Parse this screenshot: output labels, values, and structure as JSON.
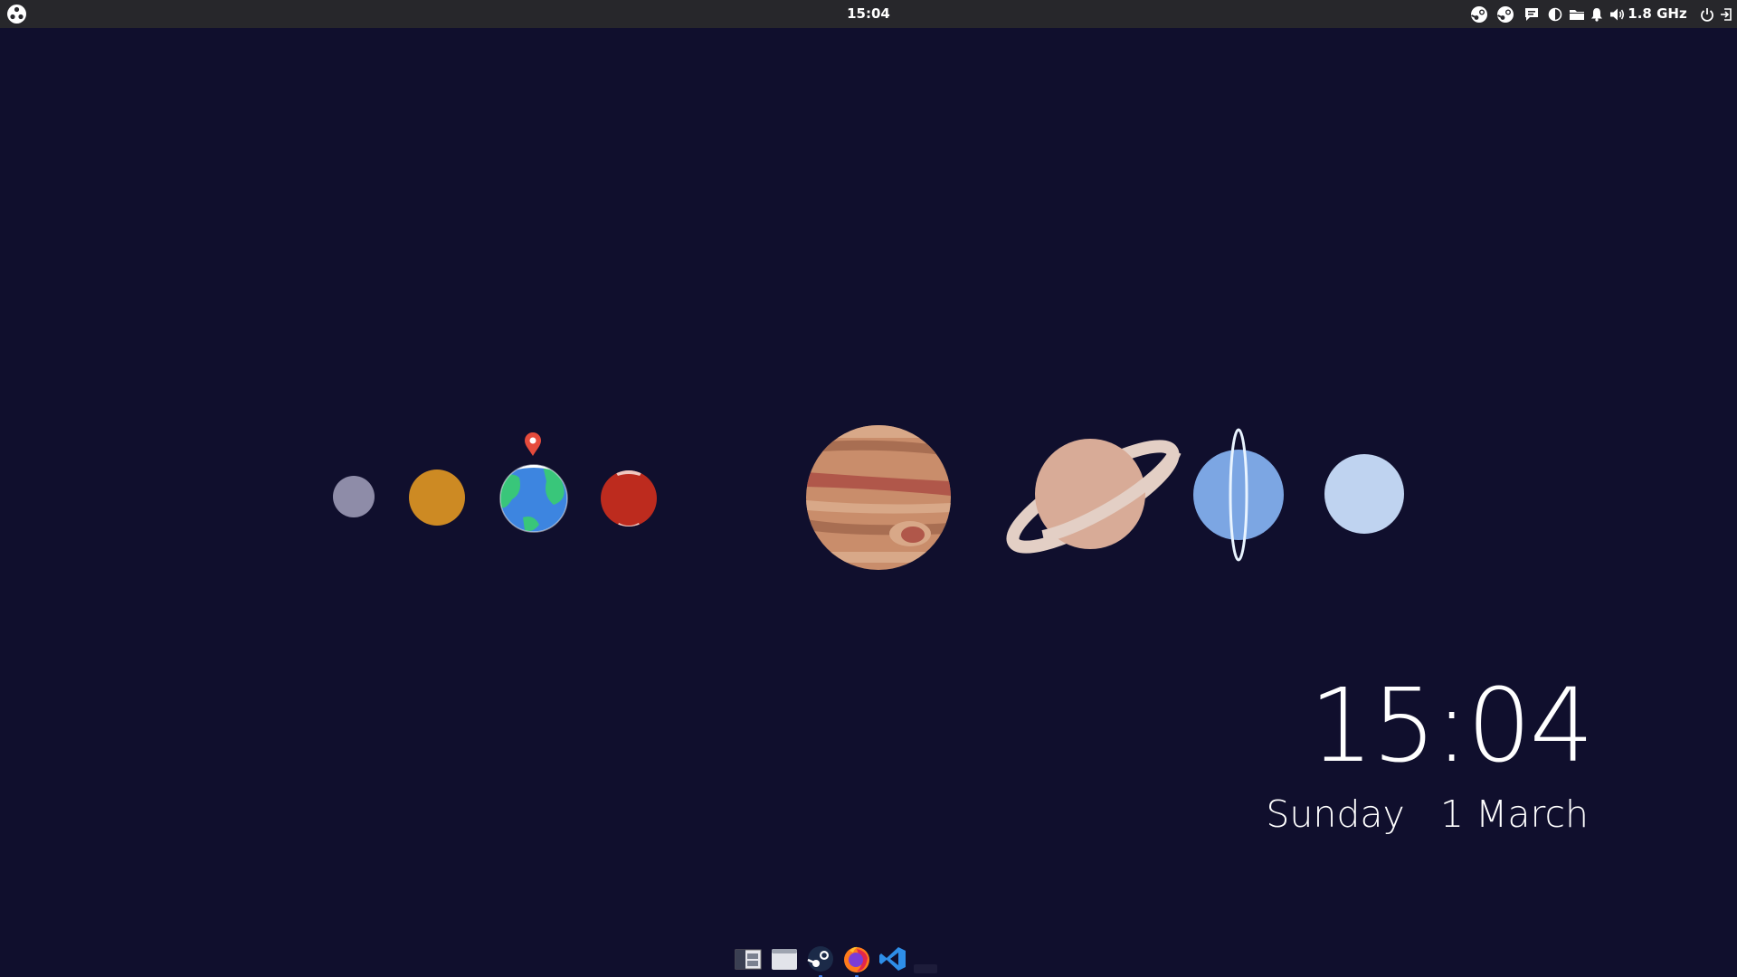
{
  "panel": {
    "menu_icon": "apps-menu-icon",
    "clock": "15:04",
    "tray_icons": [
      "steam-icon",
      "steam-icon",
      "chat-icon",
      "night-light-icon",
      "folder-icon",
      "notifications-bell-icon",
      "volume-icon"
    ],
    "cpu_frequency": "1.8 GHz",
    "right_icons": [
      "power-icon",
      "logout-icon"
    ]
  },
  "desktop": {
    "planets": [
      "mercury",
      "venus",
      "earth",
      "mars",
      "jupiter",
      "saturn",
      "uranus",
      "neptune"
    ],
    "location_marker": "map-pin-icon",
    "colors": {
      "background": "#100f2d",
      "mercury": "#8e8ca8",
      "venus": "#cd8a23",
      "earth_ocean": "#3d85e0",
      "earth_land": "#39c67a",
      "mars": "#bd2b1e",
      "jupiter": "#c98d6b",
      "saturn": "#d8ab97",
      "saturn_ring": "#e3cfc5",
      "uranus": "#7ca6e3",
      "neptune": "#bfd3f0",
      "pin": "#e54b3c"
    }
  },
  "clock_widget": {
    "time": "15:04",
    "date": "Sunday   1 March"
  },
  "dock": {
    "items": [
      {
        "name": "file-manager-icon",
        "running": false
      },
      {
        "name": "window-icon",
        "running": false
      },
      {
        "name": "steam-icon",
        "running": true
      },
      {
        "name": "firefox-icon",
        "running": true
      },
      {
        "name": "vscode-icon",
        "running": false
      }
    ]
  }
}
